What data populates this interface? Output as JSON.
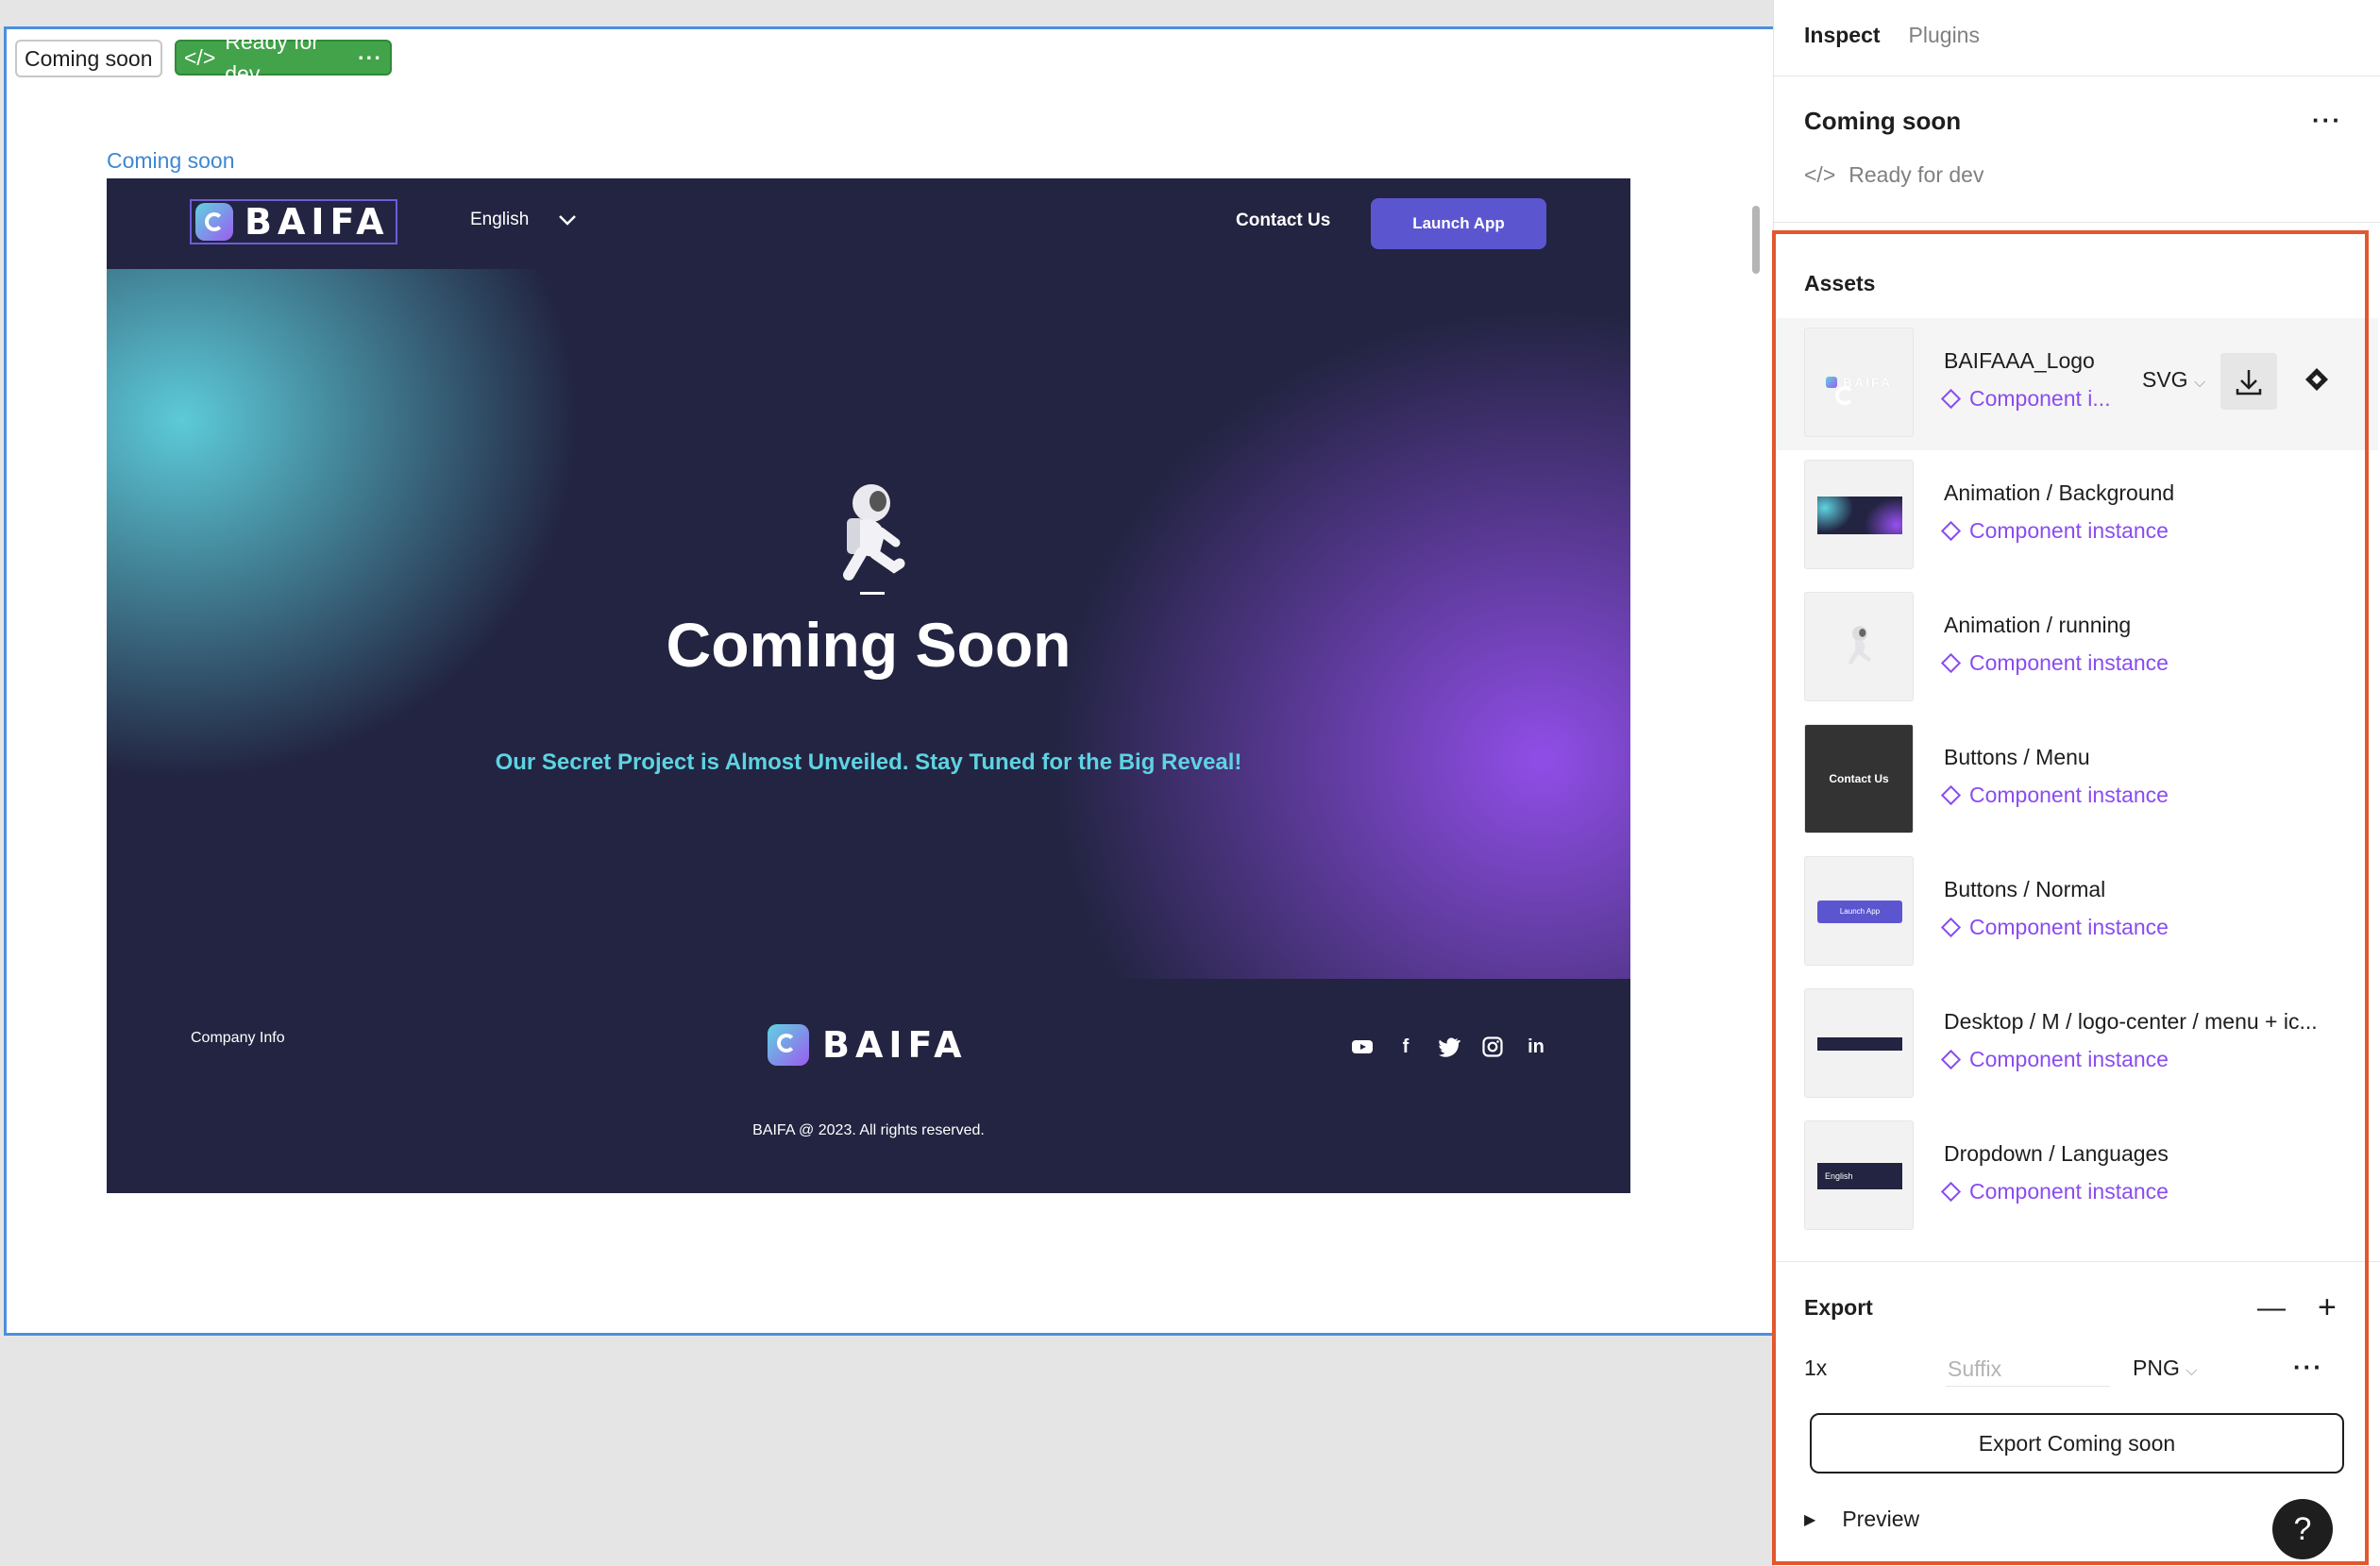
{
  "canvas": {
    "frame_chip": "Coming soon",
    "dev_chip": "Ready for dev",
    "frame_name": "Coming soon"
  },
  "site": {
    "logo_text": "BAIFA",
    "language": "English",
    "contact": "Contact Us",
    "launch": "Launch App",
    "hero_title": "Coming Soon",
    "hero_subtitle": "Our Secret Project is Almost Unveiled.  Stay Tuned for the Big Reveal!",
    "company_info": "Company Info",
    "copyright": "BAIFA @ 2023. All rights reserved.",
    "colors": {
      "bg": "#222441",
      "accent": "#5b56d0",
      "cyan": "#5ed3e2",
      "purple": "#9650f0"
    }
  },
  "panel": {
    "tabs": [
      "Inspect",
      "Plugins"
    ],
    "selection_title": "Coming soon",
    "selection_status": "Ready for dev",
    "assets_title": "Assets",
    "assets": [
      {
        "name": "BAIFAAA_Logo",
        "kind": "Component i...",
        "format": "SVG"
      },
      {
        "name": "Animation / Background",
        "kind": "Component instance"
      },
      {
        "name": "Animation / running",
        "kind": "Component instance"
      },
      {
        "name": "Buttons / Menu",
        "kind": "Component instance",
        "thumb_text": "Contact Us"
      },
      {
        "name": "Buttons / Normal",
        "kind": "Component instance",
        "thumb_text": "Launch App"
      },
      {
        "name": "Desktop / M / logo-center / menu + ic...",
        "kind": "Component instance"
      },
      {
        "name": "Dropdown / Languages",
        "kind": "Component instance",
        "thumb_text": "English"
      }
    ],
    "export": {
      "title": "Export",
      "scale": "1x",
      "suffix_placeholder": "Suffix",
      "format": "PNG",
      "button": "Export Coming soon",
      "preview": "Preview",
      "help": "?"
    },
    "colors": {
      "component": "#8a4cf0",
      "highlight": "#e2572e",
      "dev_green": "#42a34a"
    }
  }
}
